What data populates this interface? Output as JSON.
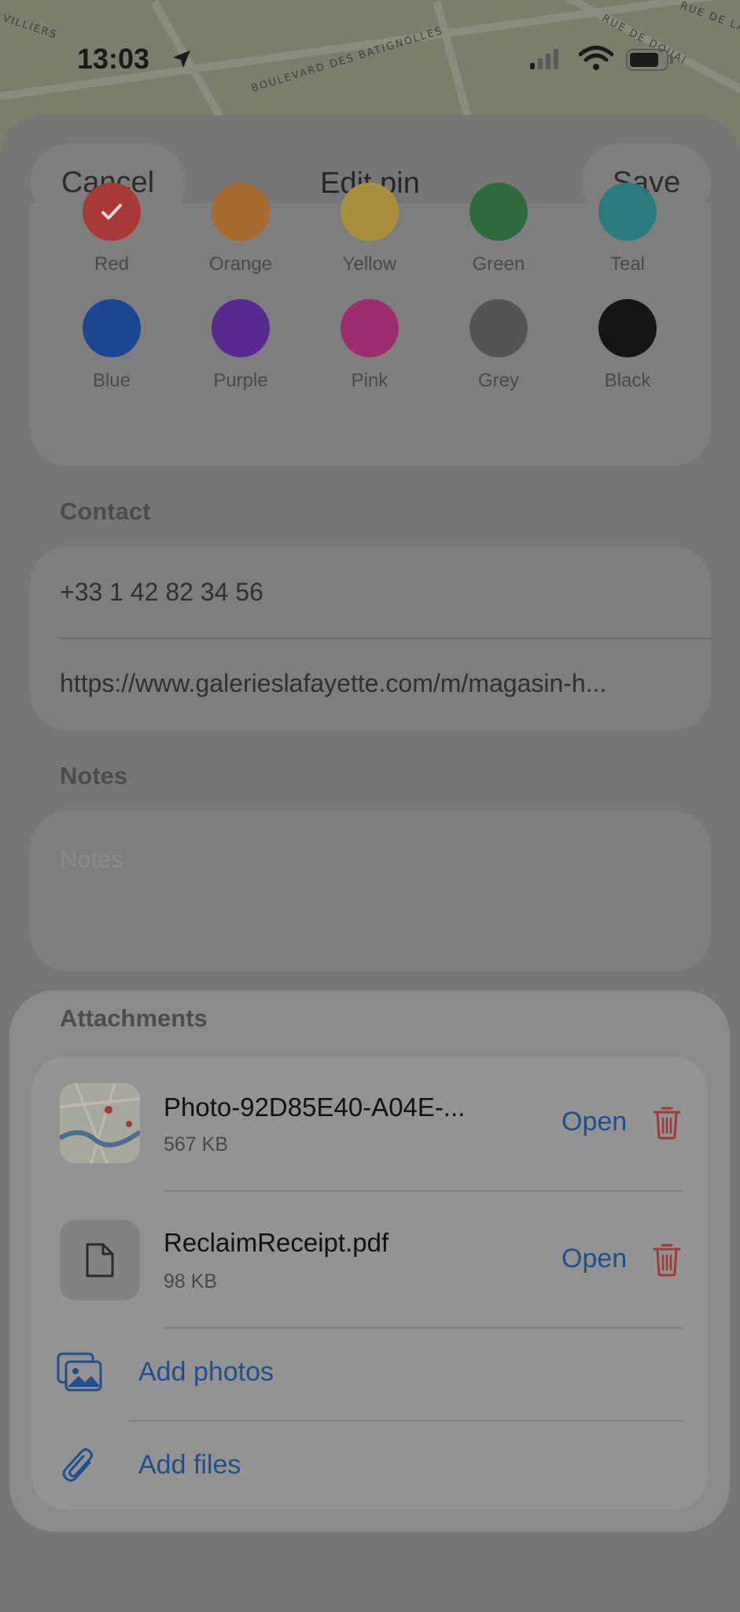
{
  "status_bar": {
    "time": "13:03"
  },
  "map": {
    "labels": [
      "VILLIERS",
      "BOULEVARD DES BATIGNOLLES",
      "RUE DE DOUAI",
      "RUE DE LA"
    ]
  },
  "nav": {
    "cancel_label": "Cancel",
    "title": "Edit pin",
    "save_label": "Save"
  },
  "colors": [
    {
      "name": "Red",
      "hex": "#a83a36",
      "selected": true
    },
    {
      "name": "Orange",
      "hex": "#a86a30"
    },
    {
      "name": "Yellow",
      "hex": "#a88f3e"
    },
    {
      "name": "Green",
      "hex": "#2e6a3c"
    },
    {
      "name": "Teal",
      "hex": "#2a7a7e"
    },
    {
      "name": "Blue",
      "hex": "#1b4694"
    },
    {
      "name": "Purple",
      "hex": "#562a8e"
    },
    {
      "name": "Pink",
      "hex": "#9a2e6e"
    },
    {
      "name": "Grey",
      "hex": "#545456"
    },
    {
      "name": "Black",
      "hex": "#151515"
    }
  ],
  "contact": {
    "section_label": "Contact",
    "phone": "+33 1 42 82 34 56",
    "url": "https://www.galerieslafayette.com/m/magasin-h..."
  },
  "notes": {
    "section_label": "Notes",
    "placeholder": "Notes"
  },
  "attachments": {
    "section_label": "Attachments",
    "files": [
      {
        "name": "Photo-92D85E40-A04E-...",
        "size": "567 KB",
        "open_label": "Open"
      },
      {
        "name": "ReclaimReceipt.pdf",
        "size": "98 KB",
        "open_label": "Open"
      }
    ],
    "add_photos_label": "Add photos",
    "add_files_label": "Add files"
  },
  "accent_color": "#204f8d",
  "destructive_color": "#a13a34"
}
